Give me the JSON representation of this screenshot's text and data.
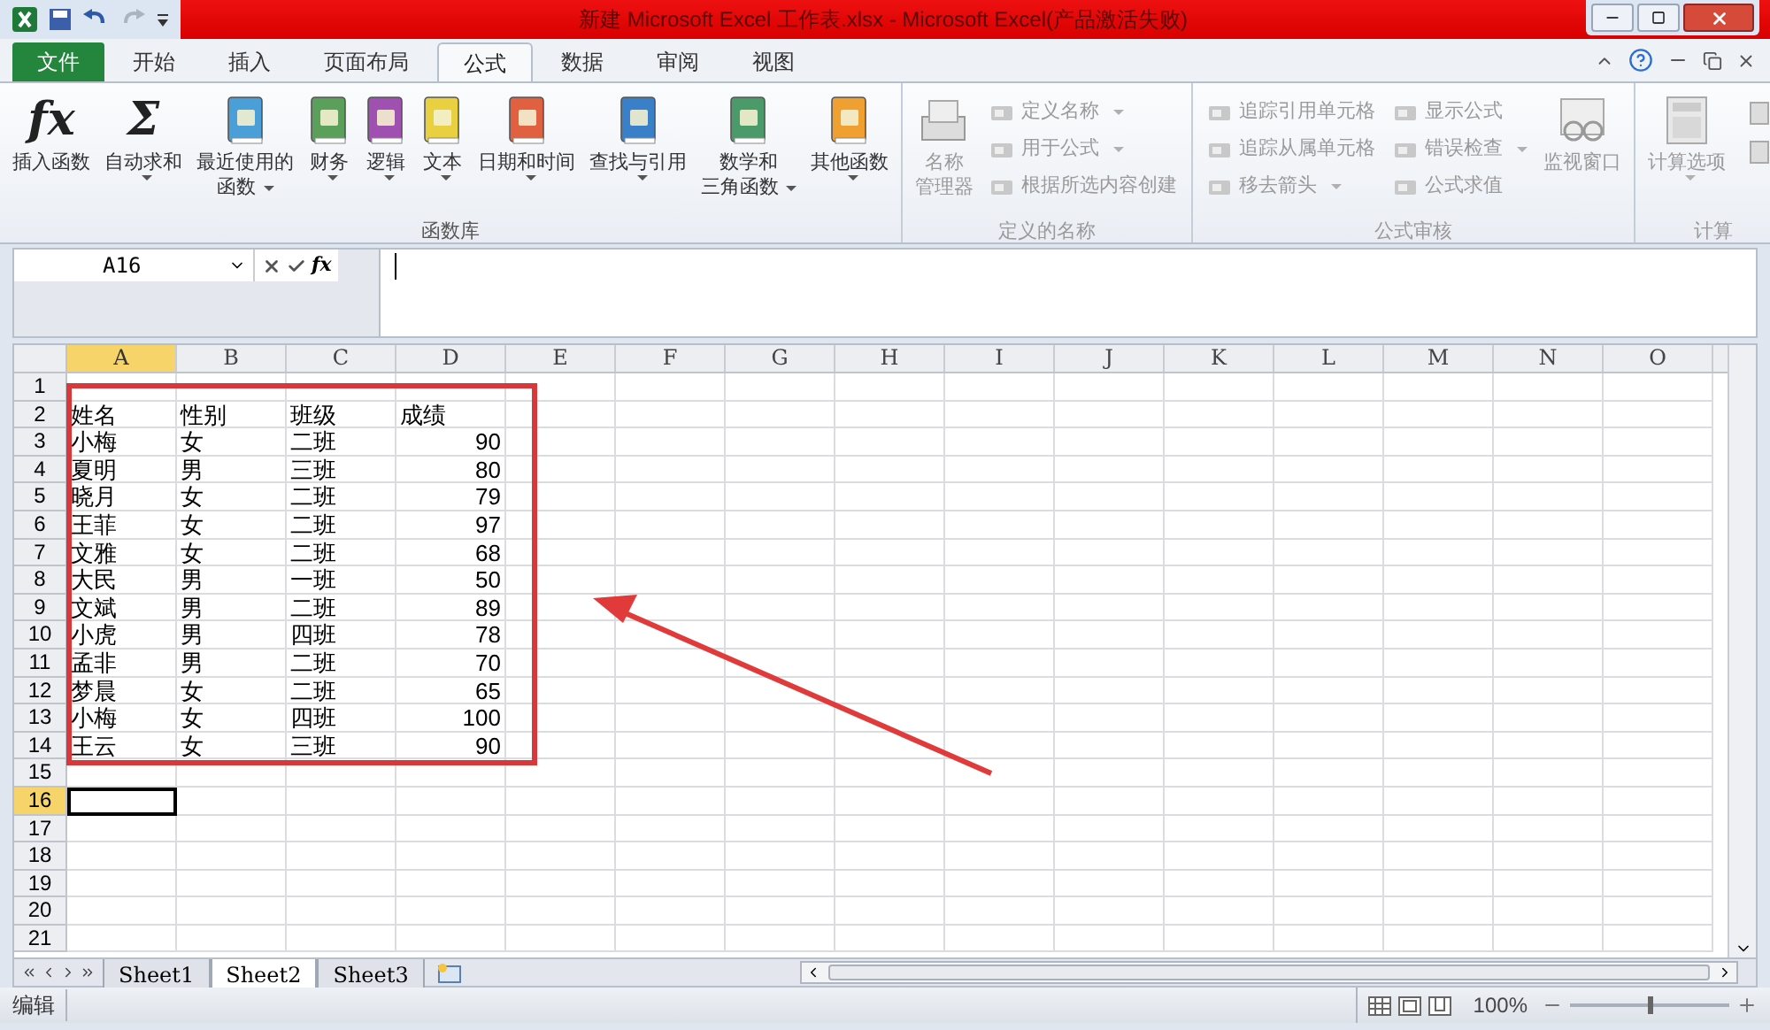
{
  "title_bar": {
    "title": "新建 Microsoft Excel 工作表.xlsx  -  Microsoft Excel(产品激活失败)"
  },
  "tabs": [
    {
      "label": "文件",
      "kind": "file",
      "selected": false
    },
    {
      "label": "开始",
      "kind": "tab",
      "selected": false
    },
    {
      "label": "插入",
      "kind": "tab",
      "selected": false
    },
    {
      "label": "页面布局",
      "kind": "tab",
      "selected": false
    },
    {
      "label": "公式",
      "kind": "tab",
      "selected": true
    },
    {
      "label": "数据",
      "kind": "tab",
      "selected": false
    },
    {
      "label": "审阅",
      "kind": "tab",
      "selected": false
    },
    {
      "label": "视图",
      "kind": "tab",
      "selected": false
    }
  ],
  "ribbon": {
    "groups": [
      {
        "label": "函数库",
        "disabled": false,
        "items": [
          {
            "kind": "large",
            "glyph": "fx",
            "lines": [
              "插入函数"
            ],
            "dropdown": false
          },
          {
            "kind": "large",
            "glyph": "Σ",
            "lines": [
              "自动求和"
            ],
            "dropdown": true
          },
          {
            "kind": "large",
            "lines": [
              "最近使用的",
              "函数"
            ],
            "dropdown": true
          },
          {
            "kind": "large",
            "lines": [
              "财务"
            ],
            "dropdown": true
          },
          {
            "kind": "large",
            "lines": [
              "逻辑"
            ],
            "dropdown": true
          },
          {
            "kind": "large",
            "lines": [
              "文本"
            ],
            "dropdown": true
          },
          {
            "kind": "large",
            "lines": [
              "日期和时间"
            ],
            "dropdown": true
          },
          {
            "kind": "large",
            "lines": [
              "查找与引用"
            ],
            "dropdown": true
          },
          {
            "kind": "large",
            "lines": [
              "数学和",
              "三角函数"
            ],
            "dropdown": true
          },
          {
            "kind": "large",
            "lines": [
              "其他函数"
            ],
            "dropdown": true
          }
        ]
      },
      {
        "label": "定义的名称",
        "disabled": true,
        "items": [
          {
            "kind": "large",
            "lines": [
              "名称",
              "管理器"
            ],
            "dropdown": false
          },
          {
            "kind": "small",
            "lines": [
              "定义名称"
            ],
            "dropdown": true
          },
          {
            "kind": "small",
            "lines": [
              "用于公式"
            ],
            "dropdown": true
          },
          {
            "kind": "small",
            "lines": [
              "根据所选内容创建"
            ],
            "dropdown": false
          }
        ]
      },
      {
        "label": "公式审核",
        "disabled": true,
        "items": [
          {
            "kind": "small",
            "lines": [
              "追踪引用单元格"
            ],
            "dropdown": false
          },
          {
            "kind": "small",
            "lines": [
              "追踪从属单元格"
            ],
            "dropdown": false
          },
          {
            "kind": "small",
            "lines": [
              "移去箭头"
            ],
            "dropdown": true
          },
          {
            "kind": "small",
            "lines": [
              "显示公式"
            ],
            "dropdown": false
          },
          {
            "kind": "small",
            "lines": [
              "错误检查"
            ],
            "dropdown": true
          },
          {
            "kind": "small",
            "lines": [
              "公式求值"
            ],
            "dropdown": false
          },
          {
            "kind": "large",
            "lines": [
              "监视窗口"
            ],
            "dropdown": false
          }
        ]
      },
      {
        "label": "计算",
        "disabled": true,
        "items": [
          {
            "kind": "large",
            "lines": [
              "计算选项"
            ],
            "dropdown": true
          },
          {
            "kind": "icon"
          },
          {
            "kind": "icon"
          }
        ]
      }
    ]
  },
  "formula_bar": {
    "name_box": "A16",
    "function_glyph": "fx"
  },
  "sheet": {
    "columns": [
      {
        "label": "A",
        "selected": true
      },
      {
        "label": "B",
        "selected": false
      },
      {
        "label": "C",
        "selected": false
      },
      {
        "label": "D",
        "selected": false
      },
      {
        "label": "E",
        "selected": false
      },
      {
        "label": "F",
        "selected": false
      },
      {
        "label": "G",
        "selected": false
      },
      {
        "label": "H",
        "selected": false
      },
      {
        "label": "I",
        "selected": false
      },
      {
        "label": "J",
        "selected": false
      },
      {
        "label": "K",
        "selected": false
      },
      {
        "label": "L",
        "selected": false
      },
      {
        "label": "M",
        "selected": false
      },
      {
        "label": "N",
        "selected": false
      },
      {
        "label": "O",
        "selected": false
      }
    ],
    "rows": [
      {
        "number": "1",
        "selected": false,
        "cells": []
      },
      {
        "number": "2",
        "selected": false,
        "cells": [
          {
            "text": "姓名",
            "kind": "text"
          },
          {
            "text": "性别",
            "kind": "text"
          },
          {
            "text": "班级",
            "kind": "text"
          },
          {
            "text": "成绩",
            "kind": "text"
          }
        ]
      },
      {
        "number": "3",
        "selected": false,
        "cells": [
          {
            "text": "小梅",
            "kind": "text"
          },
          {
            "text": "女",
            "kind": "text"
          },
          {
            "text": "二班",
            "kind": "text"
          },
          {
            "text": "90",
            "kind": "number"
          }
        ]
      },
      {
        "number": "4",
        "selected": false,
        "cells": [
          {
            "text": "夏明",
            "kind": "text"
          },
          {
            "text": "男",
            "kind": "text"
          },
          {
            "text": "三班",
            "kind": "text"
          },
          {
            "text": "80",
            "kind": "number"
          }
        ]
      },
      {
        "number": "5",
        "selected": false,
        "cells": [
          {
            "text": "晓月",
            "kind": "text"
          },
          {
            "text": "女",
            "kind": "text"
          },
          {
            "text": "二班",
            "kind": "text"
          },
          {
            "text": "79",
            "kind": "number"
          }
        ]
      },
      {
        "number": "6",
        "selected": false,
        "cells": [
          {
            "text": "王菲",
            "kind": "text"
          },
          {
            "text": "女",
            "kind": "text"
          },
          {
            "text": "二班",
            "kind": "text"
          },
          {
            "text": "97",
            "kind": "number"
          }
        ]
      },
      {
        "number": "7",
        "selected": false,
        "cells": [
          {
            "text": "文雅",
            "kind": "text"
          },
          {
            "text": "女",
            "kind": "text"
          },
          {
            "text": "二班",
            "kind": "text"
          },
          {
            "text": "68",
            "kind": "number"
          }
        ]
      },
      {
        "number": "8",
        "selected": false,
        "cells": [
          {
            "text": "大民",
            "kind": "text"
          },
          {
            "text": "男",
            "kind": "text"
          },
          {
            "text": "一班",
            "kind": "text"
          },
          {
            "text": "50",
            "kind": "number"
          }
        ]
      },
      {
        "number": "9",
        "selected": false,
        "cells": [
          {
            "text": "文斌",
            "kind": "text"
          },
          {
            "text": "男",
            "kind": "text"
          },
          {
            "text": "二班",
            "kind": "text"
          },
          {
            "text": "89",
            "kind": "number"
          }
        ]
      },
      {
        "number": "10",
        "selected": false,
        "cells": [
          {
            "text": "小虎",
            "kind": "text"
          },
          {
            "text": "男",
            "kind": "text"
          },
          {
            "text": "四班",
            "kind": "text"
          },
          {
            "text": "78",
            "kind": "number"
          }
        ]
      },
      {
        "number": "11",
        "selected": false,
        "cells": [
          {
            "text": "孟非",
            "kind": "text"
          },
          {
            "text": "男",
            "kind": "text"
          },
          {
            "text": "二班",
            "kind": "text"
          },
          {
            "text": "70",
            "kind": "number"
          }
        ]
      },
      {
        "number": "12",
        "selected": false,
        "cells": [
          {
            "text": "梦晨",
            "kind": "text"
          },
          {
            "text": "女",
            "kind": "text"
          },
          {
            "text": "二班",
            "kind": "text"
          },
          {
            "text": "65",
            "kind": "number"
          }
        ]
      },
      {
        "number": "13",
        "selected": false,
        "cells": [
          {
            "text": "小梅",
            "kind": "text"
          },
          {
            "text": "女",
            "kind": "text"
          },
          {
            "text": "四班",
            "kind": "text"
          },
          {
            "text": "100",
            "kind": "number"
          }
        ]
      },
      {
        "number": "14",
        "selected": false,
        "cells": [
          {
            "text": "王云",
            "kind": "text"
          },
          {
            "text": "女",
            "kind": "text"
          },
          {
            "text": "三班",
            "kind": "text"
          },
          {
            "text": "90",
            "kind": "number"
          }
        ]
      },
      {
        "number": "15",
        "selected": false,
        "cells": []
      },
      {
        "number": "16",
        "selected": true,
        "cells": []
      },
      {
        "number": "17",
        "selected": false,
        "cells": []
      },
      {
        "number": "18",
        "selected": false,
        "cells": []
      },
      {
        "number": "19",
        "selected": false,
        "cells": []
      },
      {
        "number": "20",
        "selected": false,
        "cells": []
      },
      {
        "number": "21",
        "selected": false,
        "cells": []
      }
    ]
  },
  "sheet_tabs": [
    {
      "label": "Sheet1",
      "selected": false
    },
    {
      "label": "Sheet2",
      "selected": true
    },
    {
      "label": "Sheet3",
      "selected": false
    }
  ],
  "status_bar": {
    "mode": "编辑",
    "zoom": "100%",
    "zoom_slider": {
      "level": 0.5
    }
  }
}
